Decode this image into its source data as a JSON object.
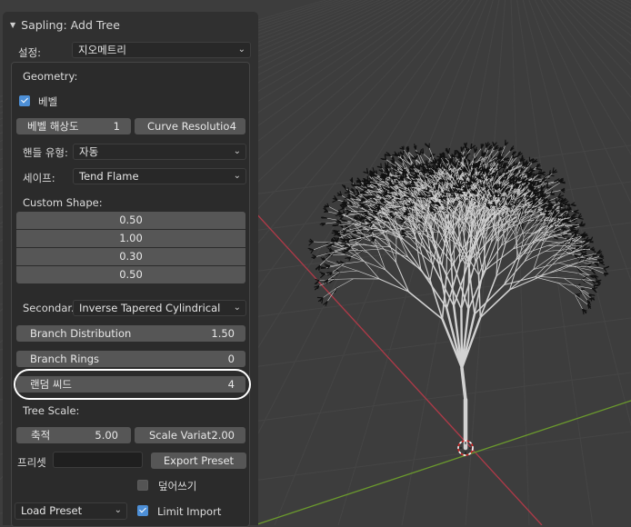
{
  "panel": {
    "title": "Sapling: Add Tree",
    "settings_label": "설정:",
    "settings_value": "지오메트리",
    "geometry_label": "Geometry:",
    "bevel_label": "베벨",
    "bevel_checked": true,
    "bevel_res_label": "베벨 해상도",
    "bevel_res_value": "1",
    "curve_res_label": "Curve Resolutio",
    "curve_res_value": "4",
    "handle_label": "핸들 유형:",
    "handle_value": "자동",
    "shape_label": "세이프:",
    "shape_value": "Tend Flame",
    "custom_shape_label": "Custom Shape:",
    "custom_shape_values": [
      "0.50",
      "1.00",
      "0.30",
      "0.50"
    ],
    "secondary_label": "Secondar..",
    "secondary_value": "Inverse Tapered Cylindrical",
    "branch_dist_label": "Branch Distribution",
    "branch_dist_value": "1.50",
    "branch_rings_label": "Branch Rings",
    "branch_rings_value": "0",
    "random_seed_label": "랜덤 씨드",
    "random_seed_value": "4",
    "tree_scale_label": "Tree Scale:",
    "scale_label": "축적",
    "scale_value": "5.00",
    "scale_var_label": "Scale Variat",
    "scale_var_value": "2.00",
    "preset_label": "프리셋",
    "preset_value": "",
    "export_label": "Export Preset",
    "overwrite_label": "덮어쓰기",
    "overwrite_checked": false,
    "load_preset_label": "Load Preset",
    "limit_import_label": "Limit Import",
    "limit_import_checked": true
  },
  "colors": {
    "viewport_bg": "#3d3d3d",
    "grid": "#454545",
    "x_axis": "#b03a48",
    "y_axis": "#6b9a2d",
    "accent": "#4d8fd6",
    "tree": "#d2d2d2",
    "leaves": "#111111"
  }
}
